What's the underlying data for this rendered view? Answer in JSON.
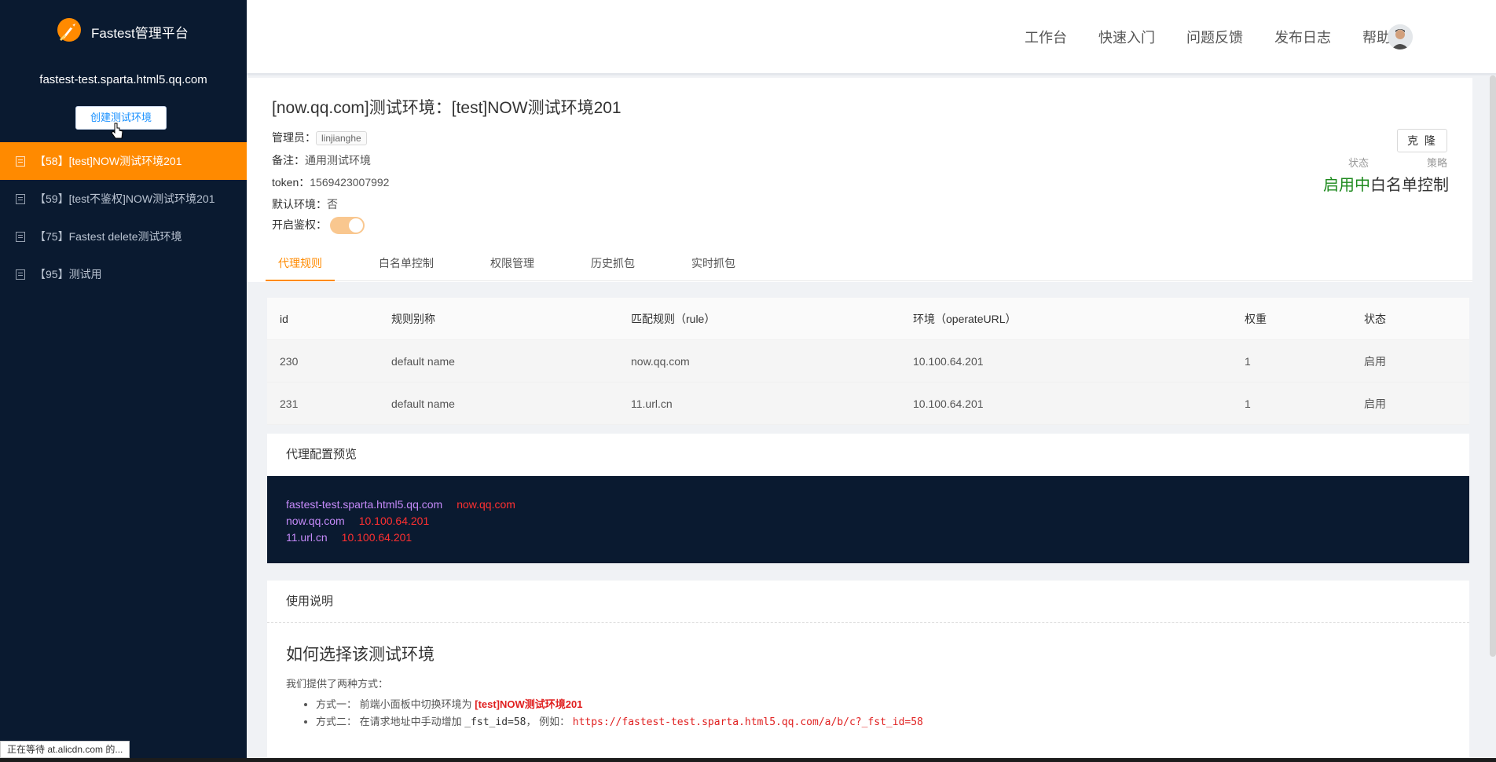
{
  "app": {
    "title": "Fastest管理平台",
    "domain": "fastest-test.sparta.html5.qq.com",
    "create_button": "创建测试环境"
  },
  "sidebar": {
    "items": [
      {
        "label": "【58】[test]NOW测试环境201",
        "active": true
      },
      {
        "label": "【59】[test不鉴权]NOW测试环境201",
        "active": false
      },
      {
        "label": "【75】Fastest delete测试环境",
        "active": false
      },
      {
        "label": "【95】测试用",
        "active": false
      }
    ]
  },
  "header": {
    "nav": [
      "工作台",
      "快速入门",
      "问题反馈",
      "发布日志",
      "帮助"
    ]
  },
  "env": {
    "title": "[now.qq.com]测试环境：[test]NOW测试环境201",
    "admin_label": "管理员：",
    "admin": "linjianghe",
    "remark_label": "备注：",
    "remark": "通用测试环境",
    "token_label": "token：",
    "token": "1569423007992",
    "default_label": "默认环境：",
    "default_value": "否",
    "auth_label": "开启鉴权：",
    "auth_enabled": true,
    "clone_button": "克 隆",
    "status_label": "状态",
    "status_value": "启用中",
    "strategy_label": "策略",
    "strategy_value": "白名单控制"
  },
  "tabs": [
    "代理规则",
    "白名单控制",
    "权限管理",
    "历史抓包",
    "实时抓包"
  ],
  "table": {
    "columns": [
      "id",
      "规则别称",
      "匹配规则（rule）",
      "环境（operateURL）",
      "权重",
      "状态"
    ],
    "rows": [
      [
        "230",
        "default name",
        "now.qq.com",
        "10.100.64.201",
        "1",
        "启用"
      ],
      [
        "231",
        "default name",
        "11.url.cn",
        "10.100.64.201",
        "1",
        "启用"
      ]
    ]
  },
  "preview": {
    "title": "代理配置预览",
    "lines": [
      {
        "host": "fastest-test.sparta.html5.qq.com",
        "target": "now.qq.com"
      },
      {
        "host": "now.qq.com",
        "target": "10.100.64.201"
      },
      {
        "host": "11.url.cn",
        "target": "10.100.64.201"
      }
    ]
  },
  "usage": {
    "title": "使用说明",
    "heading": "如何选择该测试环境",
    "intro": "我们提供了两种方式：",
    "m1_prefix": "方式一：  前端小面板中切换环境为 ",
    "m1_value": "[test]NOW测试环境201",
    "m2_prefix": "方式二：  在请求地址中手动增加 ",
    "m2_param": "_fst_id=58",
    "m2_mid": "，  例如：  ",
    "m2_example": "https://fastest-test.sparta.html5.qq.com/a/b/c?_fst_id=58"
  },
  "statusbar": "正在等待 at.alicdn.com 的...",
  "colors": {
    "sidebar_bg": "#0a1a30",
    "accent": "#ff8a00",
    "status_green": "#1e8a1e",
    "code_host": "#c58af9",
    "code_ip": "#ff3030"
  }
}
